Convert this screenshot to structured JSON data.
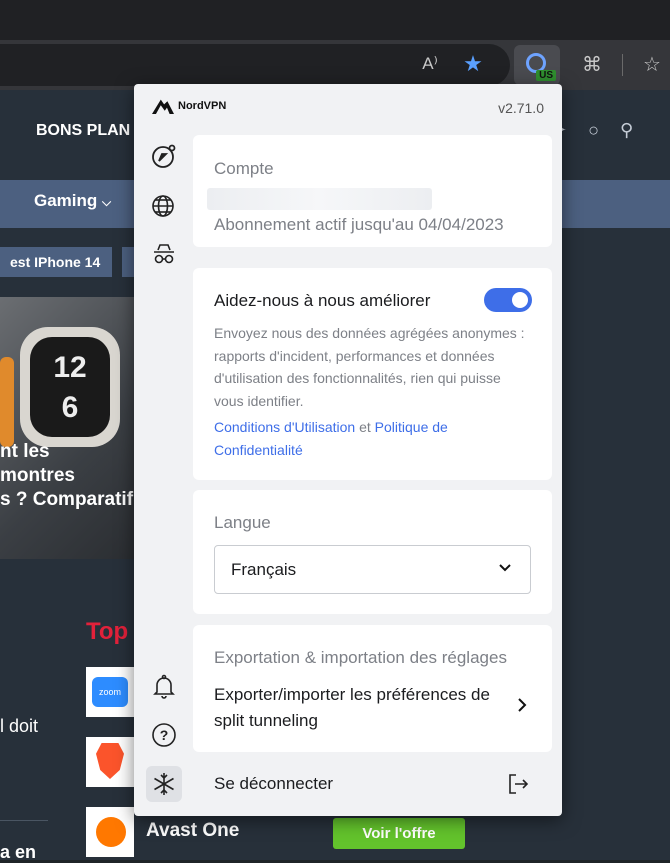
{
  "browser": {
    "read_aloud_icon": "A⁾",
    "favorite_icon": "★",
    "extension_badge": "US",
    "extensions_icon": "⌘",
    "favorites_bar_icon": "☆"
  },
  "site": {
    "bons_plans": "BONS PLAN",
    "nav_gaming": "Gaming",
    "chip_iphone": "est IPhone 14",
    "hero_lines": [
      "nt les",
      "montres",
      "s ? Comparatif"
    ],
    "top_title": "Top",
    "zoom_label": "zoom",
    "avast_name": "Avast One",
    "voir_offre": "Voir l'offre",
    "side_text_doit": "l doit",
    "side_text_aen": "a en"
  },
  "popup": {
    "brand": "NordVPN",
    "version": "v2.71.0",
    "sidebar": [
      {
        "name": "quick-connect-icon",
        "glyph": "◒"
      },
      {
        "name": "servers-globe-icon",
        "glyph": "🌐"
      },
      {
        "name": "incognito-icon",
        "glyph": "⌀"
      },
      {
        "name": "notifications-bell-icon",
        "glyph": "🔔"
      },
      {
        "name": "help-icon",
        "glyph": "?"
      },
      {
        "name": "settings-snowflake-icon",
        "glyph": "❄"
      }
    ],
    "account": {
      "label": "Compte",
      "subscription": "Abonnement actif jusqu'au 04/04/2023"
    },
    "improve": {
      "title": "Aidez-nous à nous améliorer",
      "enabled": true,
      "description": "Envoyez nous des données agrégées anonymes : rapports d'incident, performances et données d'utilisation des fonctionnalités, rien qui puisse vous identifier.",
      "terms_link": "Conditions d'Utilisation",
      "and": " et ",
      "privacy_link": "Politique de Confidentialité"
    },
    "language": {
      "label": "Langue",
      "selected": "Français"
    },
    "export": {
      "label": "Exportation & importation des réglages",
      "action": "Exporter/importer les préférences de split tunneling"
    },
    "logout": "Se déconnecter",
    "colors": {
      "accent": "#3e6ee8",
      "background": "#f1f2f4"
    }
  }
}
